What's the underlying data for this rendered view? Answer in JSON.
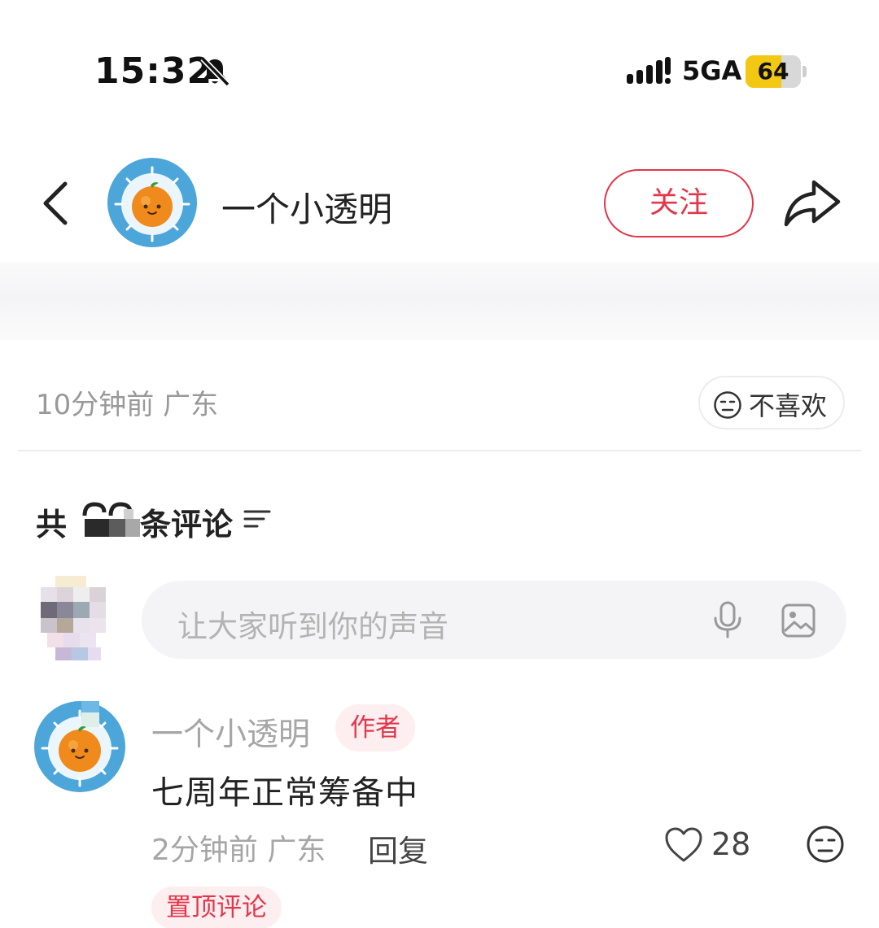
{
  "status_bar": {
    "time": "15:32",
    "network": "5GA",
    "battery_percent": "64",
    "battery_level": 0.64,
    "icons": [
      "bell-muted-icon",
      "signal-icon",
      "battery-icon"
    ]
  },
  "header": {
    "author_name": "一个小透明",
    "follow_label": "关注",
    "icons": [
      "back-arrow-icon",
      "share-icon"
    ]
  },
  "post": {
    "meta": "10分钟前 广东",
    "dislike_label": "不喜欢"
  },
  "comments": {
    "count_prefix": "共",
    "count_suffix": "条评论",
    "count_value_obscured": true,
    "input_placeholder": "让大家听到你的声音",
    "items": [
      {
        "user": "一个小透明",
        "badge": "作者",
        "text": "七周年正常筹备中",
        "meta": "2分钟前 广东",
        "reply_label": "回复",
        "likes": "28",
        "pinned_label": "置顶评论"
      }
    ]
  },
  "colors": {
    "accent": "#e3364b",
    "badge_bg": "#fdeef0",
    "battery_fill": "#f2c813",
    "avatar_bg": "#4da6d9",
    "orange": "#f08a1c"
  }
}
